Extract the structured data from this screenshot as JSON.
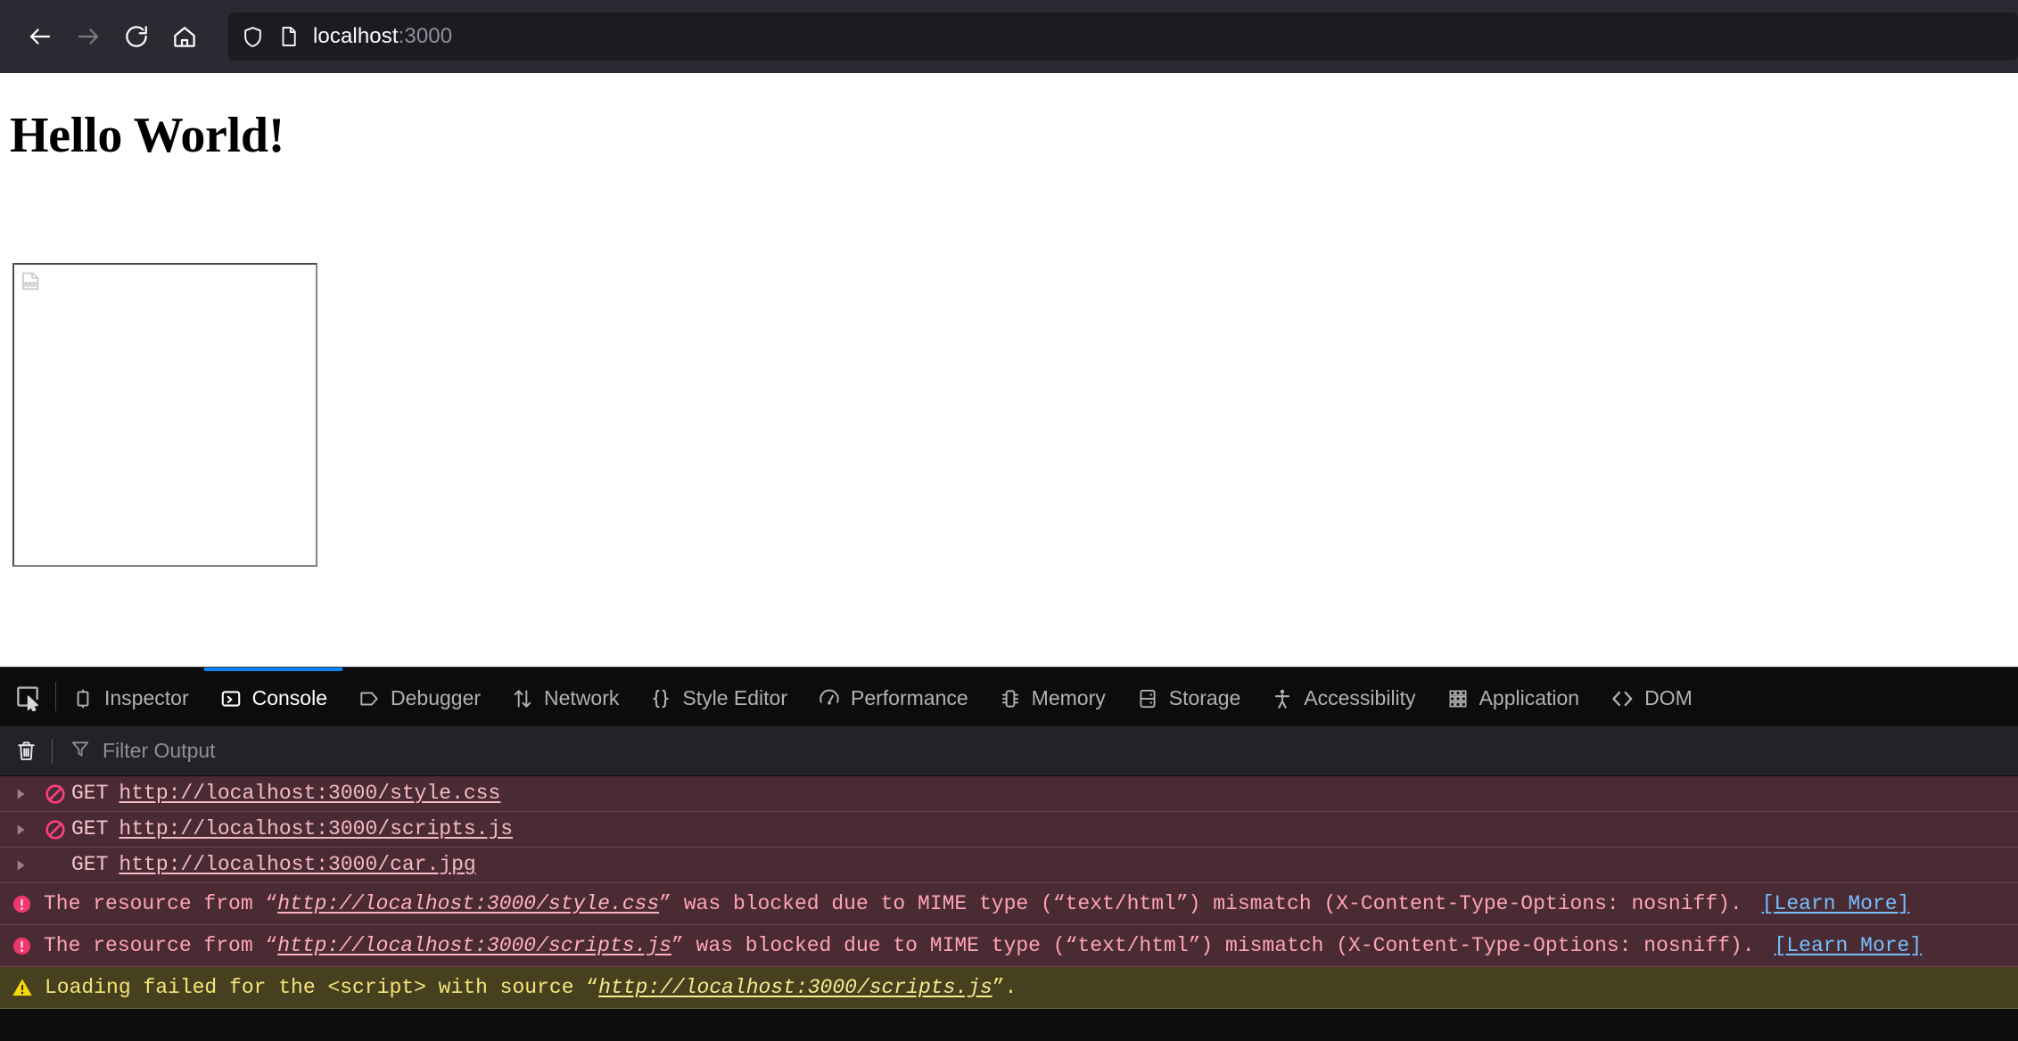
{
  "browser": {
    "nav": {
      "back_label": "Back",
      "forward_label": "Forward",
      "reload_label": "Reload",
      "home_label": "Home"
    },
    "url_bar": {
      "shield_icon": "shield-icon",
      "page_icon": "page-document-icon",
      "host": "localhost",
      "port": ":3000"
    }
  },
  "page": {
    "title": "Hello World!",
    "broken_image_alt": "broken-image-placeholder"
  },
  "devtools": {
    "picker_icon": "element-picker-icon",
    "tabs": [
      {
        "label": "Inspector",
        "icon": "inspector-icon",
        "active": false
      },
      {
        "label": "Console",
        "icon": "console-chevron-icon",
        "active": true
      },
      {
        "label": "Debugger",
        "icon": "debugger-icon",
        "active": false
      },
      {
        "label": "Network",
        "icon": "network-arrows-icon",
        "active": false
      },
      {
        "label": "Style Editor",
        "icon": "braces-icon",
        "active": false
      },
      {
        "label": "Performance",
        "icon": "gauge-icon",
        "active": false
      },
      {
        "label": "Memory",
        "icon": "memory-chip-icon",
        "active": false
      },
      {
        "label": "Storage",
        "icon": "storage-database-icon",
        "active": false
      },
      {
        "label": "Accessibility",
        "icon": "accessibility-person-icon",
        "active": false
      },
      {
        "label": "Application",
        "icon": "application-grid-icon",
        "active": false
      },
      {
        "label": "DOM",
        "icon": "dom-code-brackets-icon",
        "active": false
      }
    ],
    "toolbar": {
      "trash_icon": "trash-clear-icon",
      "filter_icon": "filter-funnel-icon",
      "filter_placeholder": "Filter Output"
    },
    "console_rows": [
      {
        "kind": "network",
        "twisty": "expand-triangle-icon",
        "blocked_icon": "blocked-circle-slash-icon",
        "method": "GET",
        "url": "http://localhost:3000/style.css"
      },
      {
        "kind": "network",
        "twisty": "expand-triangle-icon",
        "blocked_icon": "blocked-circle-slash-icon",
        "method": "GET",
        "url": "http://localhost:3000/scripts.js"
      },
      {
        "kind": "network",
        "twisty": "expand-triangle-icon",
        "blocked_icon": "",
        "method": "GET",
        "url": "http://localhost:3000/car.jpg"
      },
      {
        "kind": "error",
        "severity_icon": "error-exclamation-icon",
        "prefix": "The resource from “",
        "url": "http://localhost:3000/style.css",
        "suffix": "” was blocked due to MIME type (“text/html”) mismatch (X-Content-Type-Options: nosniff).",
        "learn_more": "[Learn More]"
      },
      {
        "kind": "error",
        "severity_icon": "error-exclamation-icon",
        "prefix": "The resource from “",
        "url": "http://localhost:3000/scripts.js",
        "suffix": "” was blocked due to MIME type (“text/html”) mismatch (X-Content-Type-Options: nosniff).",
        "learn_more": "[Learn More]"
      },
      {
        "kind": "warning",
        "severity_icon": "warning-triangle-icon",
        "prefix": "Loading failed for the <script> with source “",
        "url": "http://localhost:3000/scripts.js",
        "suffix": "”.",
        "learn_more": ""
      }
    ]
  },
  "colors": {
    "chrome_bg": "#2b2a33",
    "urlbar_bg": "#1c1b22",
    "devtools_bg": "#0c0c0d",
    "active_tab_accent": "#0a84ff",
    "error_row_bg": "#4a2b33",
    "warning_row_bg": "#46401f",
    "error_text": "#ff9eb4",
    "warning_text": "#f2e06a",
    "link_blue": "#75bfff"
  }
}
